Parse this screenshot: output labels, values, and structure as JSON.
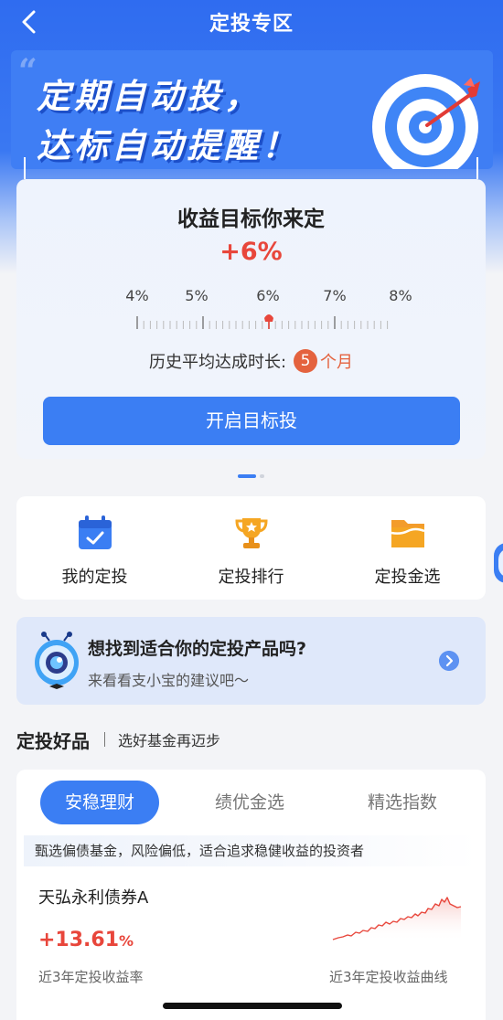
{
  "nav": {
    "title": "定投专区",
    "back_icon": "chevron-left-icon"
  },
  "banner": {
    "line1": "定期自动投，",
    "line2": "达标自动提醒！",
    "quote_mark": "“",
    "icon": "target-arrow-icon"
  },
  "goal": {
    "title": "收益目标你来定",
    "value": "+6%",
    "scale": [
      "4%",
      "5%",
      "6%",
      "7%",
      "8%"
    ],
    "selected_percent": 6,
    "avg_label": "历史平均达成时长:",
    "avg_value": "5",
    "avg_unit": "个月",
    "start_button": "开启目标投"
  },
  "pager": {
    "count": 2,
    "active": 0
  },
  "menu": {
    "items": [
      {
        "label": "我的定投",
        "icon": "calendar-check-icon"
      },
      {
        "label": "定投排行",
        "icon": "trophy-icon"
      },
      {
        "label": "定投金选",
        "icon": "folder-icon"
      }
    ]
  },
  "assistant": {
    "title": "想找到适合你的定投产品吗?",
    "subtitle": "来看看支小宝的建议吧～",
    "icon": "robot-mascot-icon"
  },
  "section": {
    "title": "定投好品",
    "subtitle": "选好基金再迈步"
  },
  "fund_tabs": [
    "安稳理财",
    "绩优金选",
    "精选指数"
  ],
  "fund_desc": "甄选偏债基金，风险偏低，适合追求稳健收益的投资者",
  "fund": {
    "name": "天弘永利债券A",
    "return_value": "+13.61",
    "return_unit": "%",
    "return_label": "近3年定投收益率",
    "curve_label": "近3年定投收益曲线"
  },
  "colors": {
    "brand_blue": "#3b7ef3",
    "accent_red": "#e8463b",
    "badge_orange": "#e4623e"
  }
}
